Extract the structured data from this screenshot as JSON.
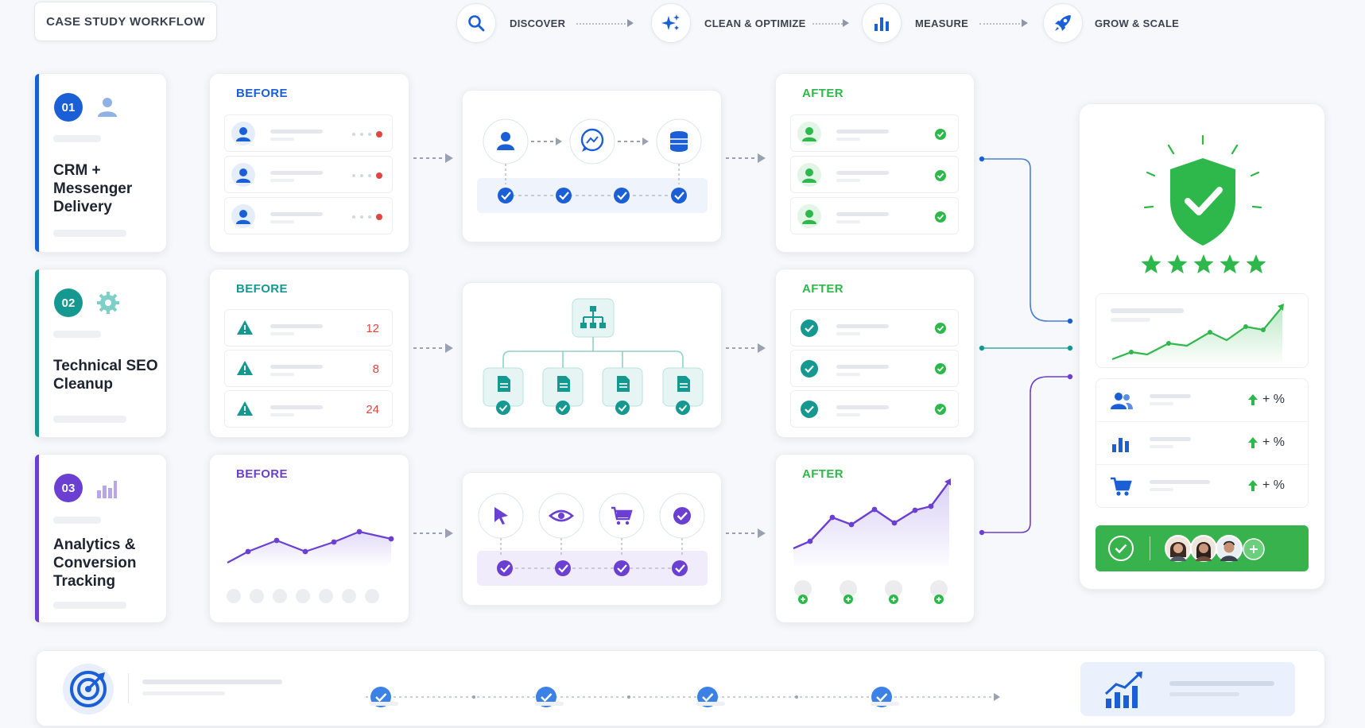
{
  "header": {
    "title": "CASE STUDY WORKFLOW",
    "steps": [
      {
        "label": "DISCOVER",
        "icon": "search-icon"
      },
      {
        "label": "CLEAN & OPTIMIZE",
        "icon": "sparkles-icon"
      },
      {
        "label": "MEASURE",
        "icon": "bar-chart-icon"
      },
      {
        "label": "GROW & SCALE",
        "icon": "rocket-icon"
      }
    ]
  },
  "cases": [
    {
      "number": "01",
      "title": "CRM + Messenger Delivery",
      "icon": "user-icon",
      "color": "#1a5fd6"
    },
    {
      "number": "02",
      "title": "Technical SEO Cleanup",
      "icon": "gear-icon",
      "color": "#14988f"
    },
    {
      "number": "03",
      "title": "Analytics & Conversion Tracking",
      "icon": "bar-chart-icon",
      "color": "#6a3fd1"
    }
  ],
  "before": {
    "label": "BEFORE",
    "seo_values": [
      "12",
      "8",
      "24"
    ]
  },
  "after": {
    "label": "AFTER"
  },
  "results": {
    "rating_stars": 5,
    "metrics": [
      {
        "icon": "users-icon",
        "change": "+ %"
      },
      {
        "icon": "bar-chart-icon",
        "change": "+ %"
      },
      {
        "icon": "cart-icon",
        "change": "+ %"
      }
    ]
  },
  "colors": {
    "blue": "#1a5fd6",
    "teal": "#14988f",
    "purple": "#6a3fd1",
    "green": "#2eb84b",
    "red": "#e0463e"
  }
}
